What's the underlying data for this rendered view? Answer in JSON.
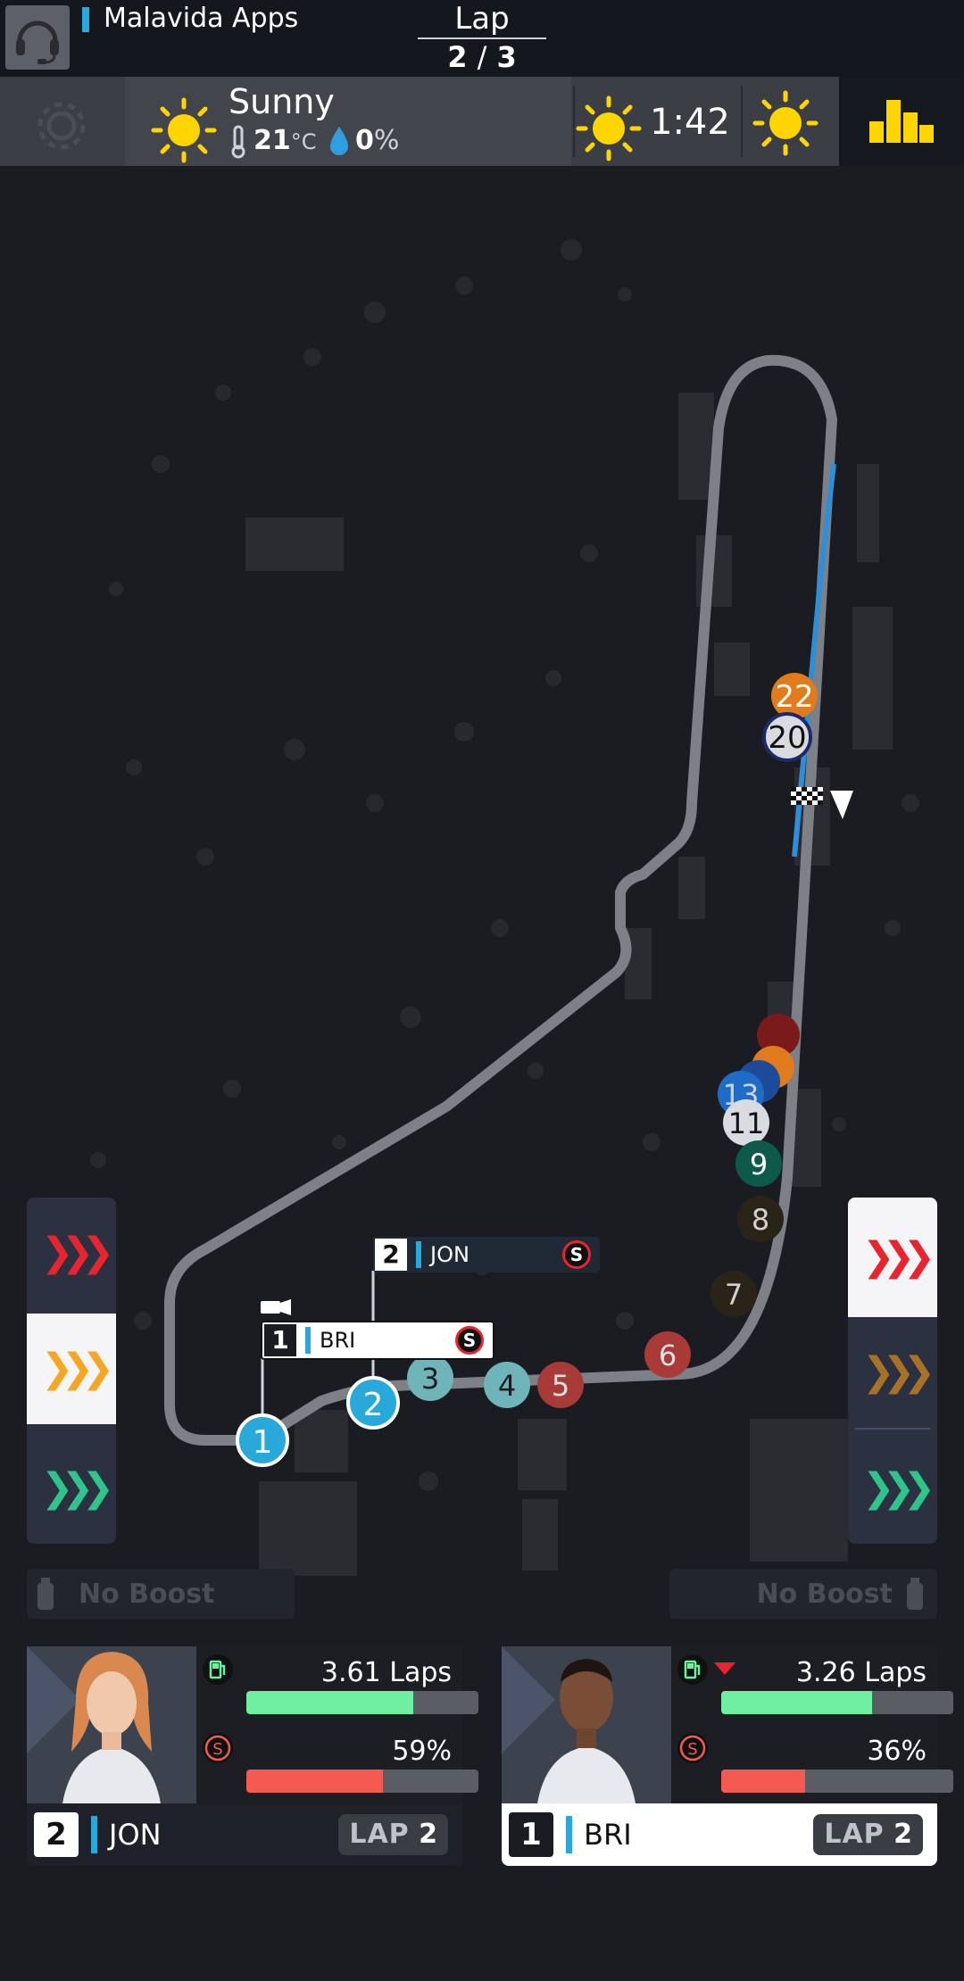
{
  "header": {
    "app_name": "Malavida Apps",
    "lap_title": "Lap",
    "lap_current": "2",
    "lap_separator": "/",
    "lap_total": "3"
  },
  "weather": {
    "condition": "Sunny",
    "temperature": "21",
    "temperature_unit": "°C",
    "rain_chance": "0",
    "rain_unit": "%",
    "forecast_time": "1:42",
    "icons": [
      "gear-icon",
      "sun-icon",
      "thermometer-icon",
      "water-drop-icon",
      "sun-icon",
      "sun-icon",
      "standings-icon"
    ]
  },
  "map": {
    "markers": [
      "1",
      "2",
      "3",
      "4",
      "5",
      "6",
      "7",
      "8",
      "9",
      "11",
      "13",
      "20",
      "22"
    ],
    "callouts": [
      {
        "position": "2",
        "name": "JON",
        "tyre": "S"
      },
      {
        "position": "1",
        "name": "BRI",
        "tyre": "S"
      }
    ]
  },
  "boost": {
    "left_label": "No Boost",
    "right_label": "No Boost"
  },
  "drivers": [
    {
      "position": "2",
      "name": "JON",
      "fuel_laps": "3.61 Laps",
      "fuel_fraction": 0.72,
      "tyre": "S",
      "tyre_pct": "59%",
      "tyre_fraction": 0.59,
      "lap_label": "LAP",
      "lap_value": "2"
    },
    {
      "position": "1",
      "name": "BRI",
      "fuel_laps": "3.26 Laps",
      "fuel_fraction": 0.65,
      "tyre": "S",
      "tyre_pct": "36%",
      "tyre_fraction": 0.36,
      "lap_label": "LAP",
      "lap_value": "2"
    }
  ],
  "colors": {
    "accent_blue": "#29a9d9",
    "fuel_green": "#6ff0a0",
    "tyre_red": "#f25a52",
    "boost_red": "#e8252e",
    "boost_orange": "#f5a623",
    "boost_green": "#2fc48a",
    "sun_yellow": "#ffd500"
  }
}
